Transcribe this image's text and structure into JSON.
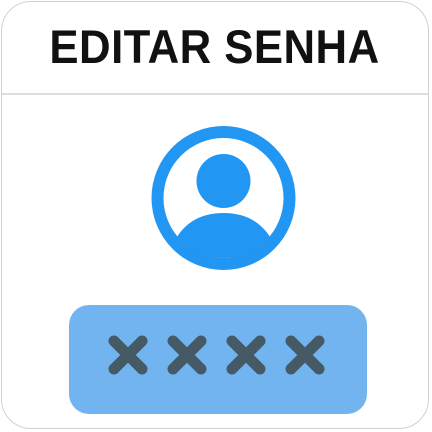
{
  "header": {
    "title": "EDITAR SENHA"
  },
  "avatar": {
    "icon": "user-circle-icon",
    "color": "#2196f3"
  },
  "password_field": {
    "icon": "masked-password-icon",
    "mask_characters": 4,
    "background_color": "#72b4f0",
    "mask_color": "#455a64"
  }
}
